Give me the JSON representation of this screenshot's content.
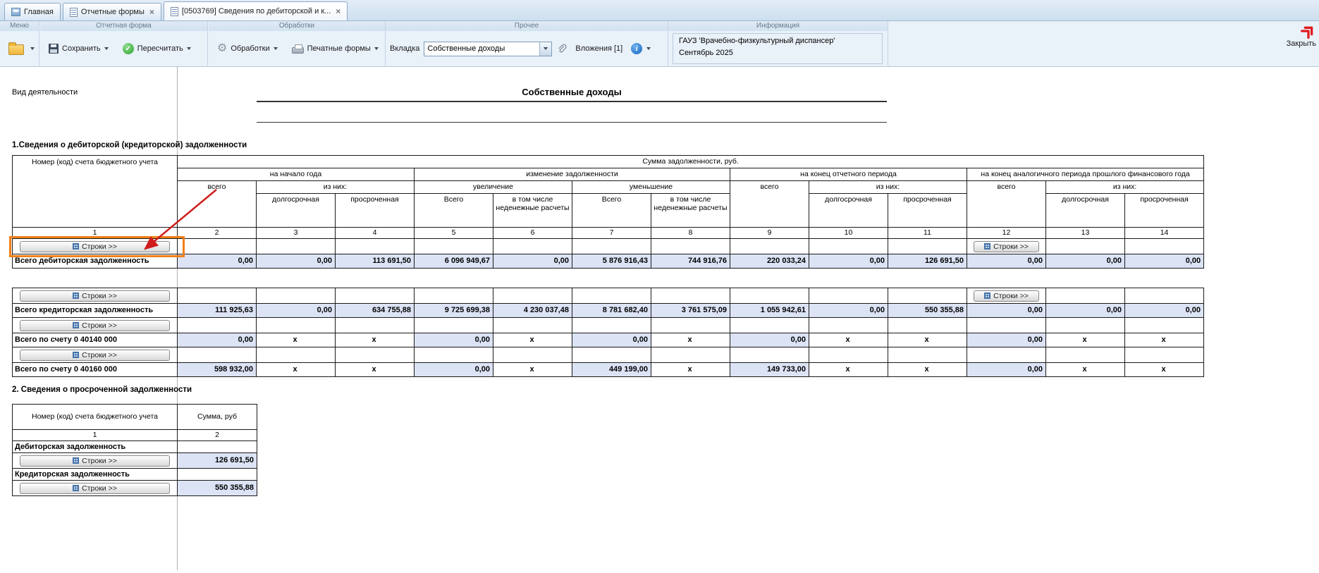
{
  "colors": {
    "highlight_orange": "#f08018",
    "arrow_red": "#cf1d1d",
    "cell_fill": "#dce3f5"
  },
  "tabbar": {
    "tabs": [
      {
        "label": "Главная"
      },
      {
        "label": "Отчетные формы"
      },
      {
        "label": "[0503769] Сведения по дебиторской и к..."
      }
    ]
  },
  "toolbar": {
    "menu_group_title": "Меню",
    "report_group_title": "Отчетная форма",
    "save_button": "Сохранить",
    "recalc_button": "Пересчитать",
    "processing_group_title": "Обработки",
    "processing_button": "Обработки",
    "print_button": "Печатные формы",
    "other_group_title": "Прочее",
    "tab_field_label": "Вкладка",
    "tab_field_value": "Собственные доходы",
    "attachments_label": "Вложения [1]",
    "info_group_title": "Информация",
    "organization": "ГАУЗ 'Врачебно-физкультурный диспансер'",
    "period": "Сентябрь 2025",
    "close_button": "Закрыть"
  },
  "form": {
    "activity_label": "Вид деятельности",
    "title": "Собственные доходы",
    "section1_title": "1.Сведения о дебиторской (кредиторской) задолженности",
    "section2_title": "2. Сведения о просроченной задолженности"
  },
  "ui": {
    "rows_button": "Строки >>"
  },
  "table1": {
    "header": {
      "account": "Номер (код) счета бюджетного учета",
      "sum_title": "Сумма задолженности, руб.",
      "begin_year": "на начало года",
      "change": "изменение задолженности",
      "end_period": "на конец отчетного периода",
      "prev_year": "на конец аналогичного периода прошлого финансового года",
      "total_low": "всего",
      "of_them": "из них:",
      "increase": "увеличение",
      "decrease": "уменьшение",
      "long_term": "долгосрочная",
      "overdue": "просроченная",
      "total_cap": "Всего",
      "non_cash": "в том числе неденежные расчеты"
    },
    "col_numbers": [
      "1",
      "2",
      "3",
      "4",
      "5",
      "6",
      "7",
      "8",
      "9",
      "10",
      "11",
      "12",
      "13",
      "14"
    ],
    "rows": [
      {
        "label": "Всего дебиторская задолженность",
        "values": [
          "0,00",
          "0,00",
          "113 691,50",
          "6 096 949,67",
          "0,00",
          "5 876 916,43",
          "744 916,76",
          "220 033,24",
          "0,00",
          "126 691,50",
          "0,00",
          "0,00",
          "0,00"
        ]
      }
    ]
  },
  "table2": {
    "rows": [
      {
        "label": "Всего кредиторская задолженность",
        "values": [
          "111 925,63",
          "0,00",
          "634 755,88",
          "9 725 699,38",
          "4 230 037,48",
          "8 781 682,40",
          "3 761 575,09",
          "1 055 942,61",
          "0,00",
          "550 355,88",
          "0,00",
          "0,00",
          "0,00"
        ]
      },
      {
        "label": "Всего по счету 0 40140 000",
        "values": [
          "0,00",
          "x",
          "x",
          "0,00",
          "x",
          "0,00",
          "x",
          "0,00",
          "x",
          "x",
          "0,00",
          "x",
          "x"
        ]
      },
      {
        "label": "Всего по счету 0 40160 000",
        "values": [
          "598 932,00",
          "x",
          "x",
          "0,00",
          "x",
          "449 199,00",
          "x",
          "149 733,00",
          "x",
          "x",
          "0,00",
          "x",
          "x"
        ]
      }
    ]
  },
  "table3": {
    "header_account": "Номер (код) счета бюджетного учета",
    "header_sum": "Сумма, руб",
    "col_numbers": [
      "1",
      "2"
    ],
    "sections": [
      {
        "label": "Дебиторская задолженность",
        "value": "126 691,50"
      },
      {
        "label": "Кредиторская задолженность",
        "value": "550 355,88"
      }
    ]
  }
}
